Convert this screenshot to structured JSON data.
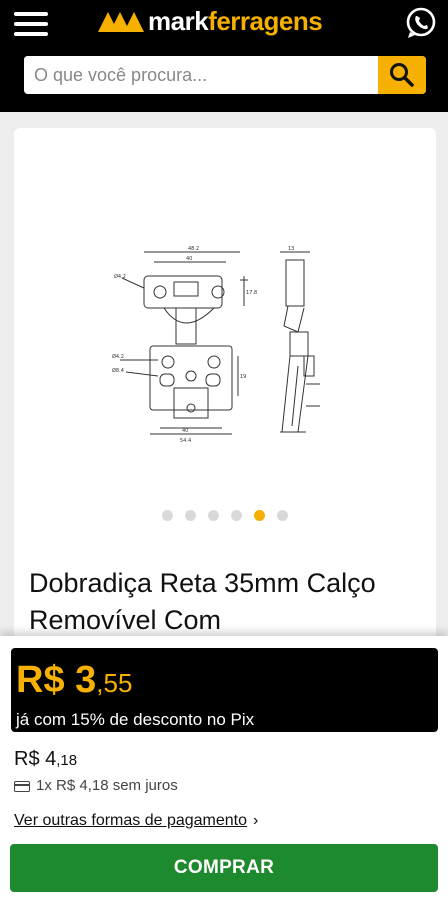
{
  "header": {
    "brand_mark": "mark",
    "brand_highlight": "ferragens",
    "menu_icon": "hamburger-menu-icon",
    "whatsapp_icon": "whatsapp-icon",
    "colors": {
      "background": "#000000",
      "accent": "#f5b000"
    }
  },
  "search": {
    "placeholder": "O que você procura...",
    "value": "",
    "icon": "search-icon"
  },
  "gallery": {
    "image_alt": "Dobradiça Reta 35mm technical drawing",
    "dot_count": 6,
    "active_index": 4
  },
  "product": {
    "title": "Dobradiça Reta 35mm Calço Removível Com"
  },
  "pricing": {
    "pix_price_main": "R$ 3",
    "pix_price_cents": ",55",
    "pix_note": "já com 15% de desconto no Pix",
    "regular_main": "R$ 4",
    "regular_cents": ",18",
    "installment": "1x R$ 4,18 sem juros",
    "payments_link": "Ver outras formas de pagamento",
    "payments_chevron": "›",
    "buy_label": "COMPRAR",
    "colors": {
      "buy": "#1e8a2e",
      "pix_price": "#f5b000"
    }
  }
}
